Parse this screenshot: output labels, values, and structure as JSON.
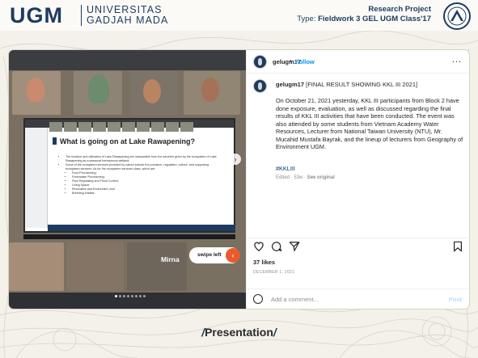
{
  "header": {
    "logo_text": "UGM",
    "university_line1": "UNIVERSITAS",
    "university_line2": "GADJAH MADA",
    "project_title": "Research Project",
    "project_type_prefix": "Type:",
    "project_type": "Fieldwork 3 GEL UGM Class'17"
  },
  "post": {
    "username": "gelugm17",
    "separator": "•",
    "follow_label": "Follow",
    "more_label": "...",
    "caption_username": "gelugm17",
    "caption_title": "[FINAL RESULT SHOWING KKL III 2021]",
    "caption_body": "On October 21, 2021 yesterday, KKL III participants from Block 2 have done exposure, evaluation, as well as discussed regarding the final results of KKL III activities that have been conducted. The event was also attended by some students from Vietnam Academy Water Resources, Lecturer from National Taiwan University (NTU), Mr. Mucahid Mustafa Bayrak, and the lineup of lecturers from Geography of Environment UGM.",
    "hashtag": "#KKLIII",
    "edited": "Edited",
    "edited_age": "53w",
    "see_original": "See original",
    "likes": "37 likes",
    "date": "DECEMBER 1, 2021",
    "comment_placeholder": "Add a comment...",
    "post_label": "Post"
  },
  "media": {
    "slide_title": "What is going on at Lake Rawapening?",
    "slide_bullets": [
      "The function and utilization of Lake Rawapening are inseparable from the services given by the ecosystem of Lake Rawapening as a seasonal herbaceous wetland.",
      "Some of the ecosystem services provided by nature include the provision, regulation, culture, and supporting ecosystem services. As for the ecosystem services class, which are:",
      "Food Provisioning;",
      "Freshwater Provisioning;",
      "Flow Regulating and Flood Control;",
      "Living Space;",
      "Recreation and Ecotourism; and",
      "Breeding Habitat."
    ],
    "participant_name": "Mirna",
    "swipe_label": "swipe left",
    "slide_count": 8,
    "active_slide": 0
  },
  "footer": {
    "label": "Presentation"
  },
  "colors": {
    "brand": "#1d3b5e",
    "accent": "#ea5a2f",
    "follow_blue": "#0095f6"
  }
}
